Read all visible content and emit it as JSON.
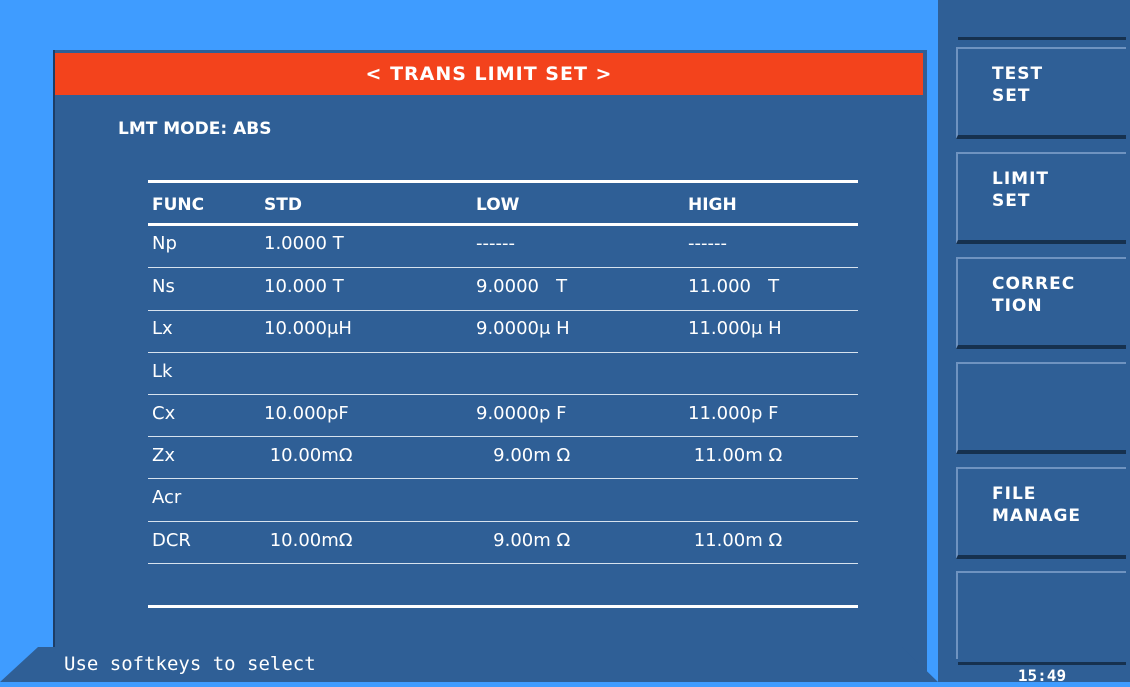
{
  "title": "< TRANS LIMIT SET >",
  "limit_mode": "LMT MODE: ABS",
  "table": {
    "headers": [
      "FUNC",
      "STD",
      "LOW",
      "HIGH"
    ],
    "rows": [
      {
        "func": "Np",
        "std": "1.0000 T",
        "low": "------",
        "high": "------"
      },
      {
        "func": "Ns",
        "std": "10.000 T",
        "low": "9.0000   T",
        "high": "11.000   T"
      },
      {
        "func": "Lx",
        "std": "10.000μH",
        "low": "9.0000μ H",
        "high": "11.000μ H"
      },
      {
        "func": "Lk",
        "std": "",
        "low": "",
        "high": ""
      },
      {
        "func": "Cx",
        "std": "10.000pF",
        "low": "9.0000p F",
        "high": "11.000p F"
      },
      {
        "func": "Zx",
        "std": " 10.00mΩ",
        "low": "   9.00m Ω",
        "high": " 11.00m Ω"
      },
      {
        "func": "Acr",
        "std": "",
        "low": "",
        "high": ""
      },
      {
        "func": "DCR",
        "std": " 10.00mΩ",
        "low": "   9.00m Ω",
        "high": " 11.00m Ω"
      }
    ]
  },
  "status": "Use softkeys to select",
  "softkeys": [
    {
      "label": "TEST\nSET"
    },
    {
      "label": "LIMIT\nSET"
    },
    {
      "label": "CORREC\nTION"
    },
    {
      "label": ""
    },
    {
      "label": "FILE\nMANAGE"
    },
    {
      "label": ""
    }
  ],
  "clock": "15:49"
}
